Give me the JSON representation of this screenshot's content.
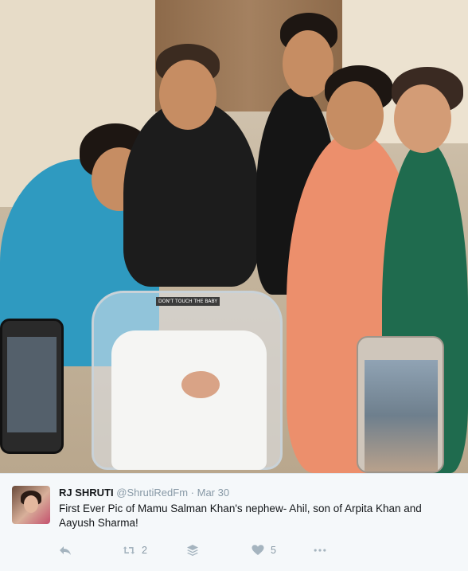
{
  "tweet": {
    "author_name": "RJ SHRUTI",
    "handle": "@ShrutiRedFm",
    "separator": "·",
    "date": "Mar 30",
    "text": "First Ever Pic of Mamu Salman Khan's nephew- Ahil, son of Arpita Khan and Aayush Sharma!",
    "photo_tag_text": "DON'T TOUCH THE BABY",
    "actions": {
      "reply_icon": "reply-icon",
      "retweet_icon": "retweet-icon",
      "retweet_count": "2",
      "buffer_icon": "buffer-stack-icon",
      "like_icon": "heart-icon",
      "like_count": "5",
      "more_icon": "more-dots-icon"
    }
  },
  "colors": {
    "background": "#f5f8fa",
    "text": "#14171a",
    "muted": "#8899a6",
    "icon": "#a5b4bf"
  }
}
